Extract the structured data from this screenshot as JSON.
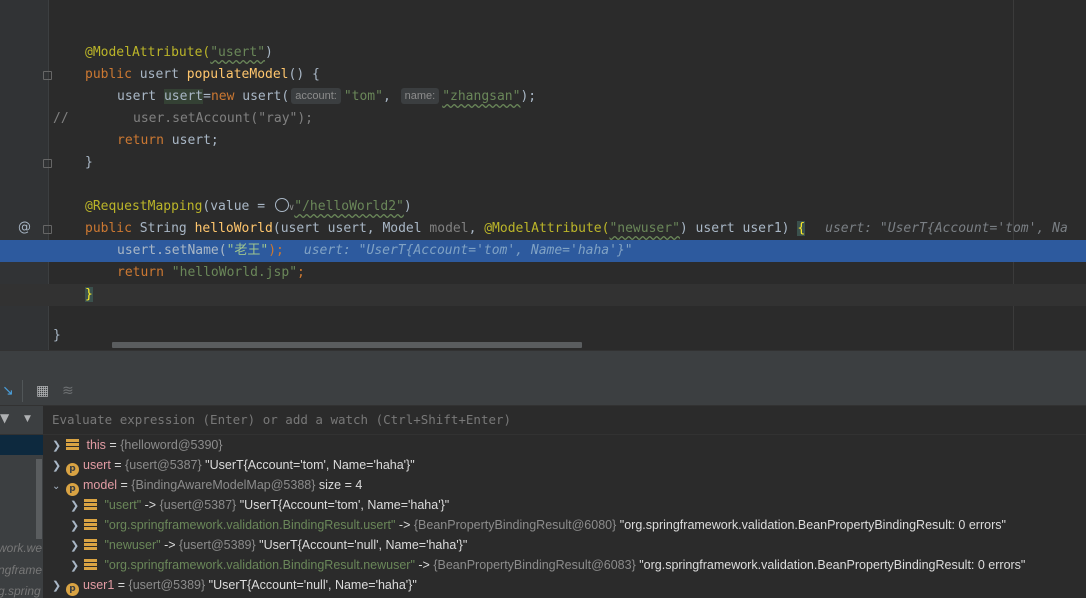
{
  "editor": {
    "lines": {
      "l1_ann": "@ModelAttribute(",
      "l1_str": "\"usert\"",
      "l1_end": ")",
      "l2_kw": "public ",
      "l2_type": "usert ",
      "l2_fn": "populateModel",
      "l2_end": "() {",
      "l3_a": "usert ",
      "l3_var": "usert",
      "l3_eq": "=",
      "l3_kw": "new ",
      "l3_b": "usert(",
      "l3_hint1": "account:",
      "l3_s1": "\"tom\"",
      "l3_comma": ", ",
      "l3_hint2": "name:",
      "l3_s2": "\"zhangsan\"",
      "l3_end": ");",
      "l4_cm": "//",
      "l4_code": "user.setAccount(\"ray\");",
      "l5_kw": "return ",
      "l5_rest": "usert;",
      "l6": "}",
      "l8_ann": "@RequestMapping",
      "l8_a": "(value = ",
      "l8_globe_arrow": "∨",
      "l8_str": "\"/helloWorld2\"",
      "l8_end": ")",
      "l9_kw": "public ",
      "l9_a": "String ",
      "l9_fn": "helloWorld",
      "l9_b": "(usert usert, Model ",
      "l9_model": "model",
      "l9_c": ", ",
      "l9_ann": "@ModelAttribute(",
      "l9_str": "\"newuser\"",
      "l9_d": ") usert user1) ",
      "l9_brace": "{",
      "l9_inline": "usert: \"UserT{Account='tom', Na",
      "l10_a": "usert.setName(",
      "l10_str": "\"老王\"",
      "l10_end": ");",
      "l10_inline": "usert: \"UserT{Account='tom', Name='haha'}\"",
      "l11_kw": "return ",
      "l11_str": "\"helloWorld.jsp\"",
      "l11_end": ";",
      "l12": "}",
      "l14": "}"
    },
    "gutter": {
      "at_mark": "@"
    }
  },
  "evaluate": {
    "placeholder": "Evaluate expression (Enter) or add a watch (Ctrl+Shift+Enter)"
  },
  "frames": {
    "items": [
      "work.we",
      "ngframe",
      "g.spring"
    ]
  },
  "variables": [
    {
      "name": "this",
      "type": "{helloword@5390}",
      "value": "",
      "icon": "list-icon"
    },
    {
      "name": "usert",
      "type": "{usert@5387}",
      "value": "\"UserT{Account='tom', Name='haha'}\"",
      "icon": "p-icon"
    },
    {
      "name": "model",
      "type": "{BindingAwareModelMap@5388}",
      "value": "size = 4",
      "icon": "p-icon"
    },
    {
      "key": "\"usert\"",
      "type": "{usert@5387}",
      "value": "\"UserT{Account='tom', Name='haha'}\""
    },
    {
      "key": "\"org.springframework.validation.BindingResult.usert\"",
      "type": "{BeanPropertyBindingResult@6080}",
      "value": "\"org.springframework.validation.BeanPropertyBindingResult: 0 errors\""
    },
    {
      "key": "\"newuser\"",
      "type": "{usert@5389}",
      "value": "\"UserT{Account='null', Name='haha'}\""
    },
    {
      "key": "\"org.springframework.validation.BindingResult.newuser\"",
      "type": "{BeanPropertyBindingResult@6083}",
      "value": "\"org.springframework.validation.BeanPropertyBindingResult: 0 errors\""
    },
    {
      "name": "user1",
      "type": "{usert@5389}",
      "value": "\"UserT{Account='null', Name='haha'}\"",
      "icon": "p-icon"
    }
  ],
  "labels": {
    "eq": " = ",
    "arrow_sep": " -> ",
    "p": "p"
  }
}
